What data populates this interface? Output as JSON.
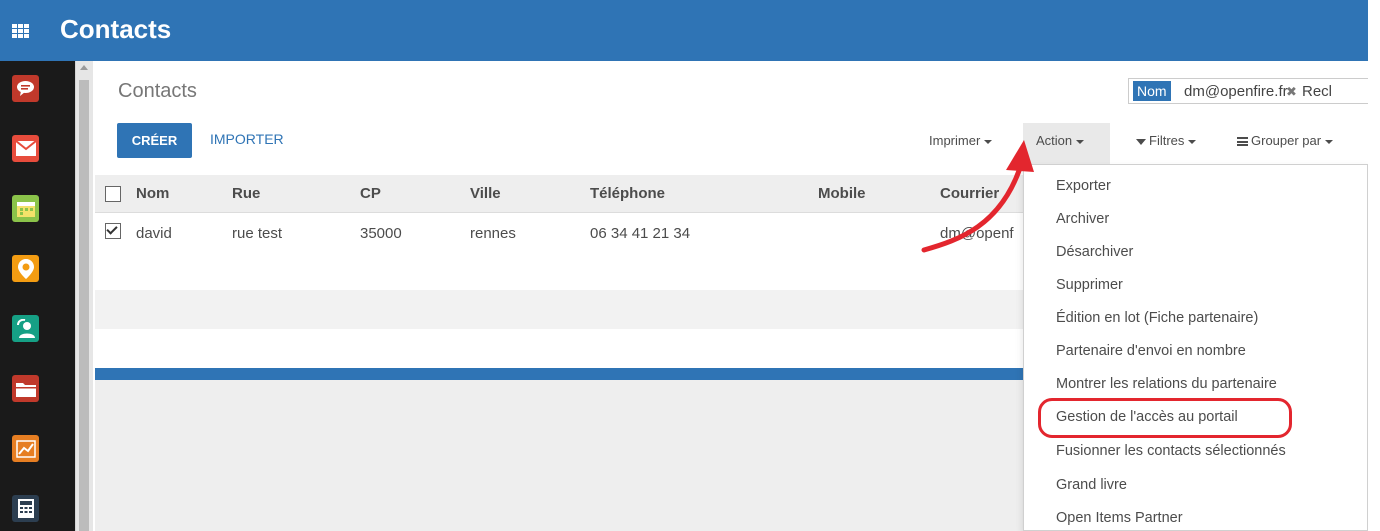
{
  "app": {
    "title": "Contacts"
  },
  "breadcrumb": "Contacts",
  "search": {
    "facet_name": "Nom",
    "facet_value": "dm@openfire.fr",
    "remove_glyph": "✖",
    "input_partial": "Recl"
  },
  "buttons": {
    "create": "CRÉER",
    "import": "IMPORTER"
  },
  "toolbar": {
    "print": "Imprimer",
    "action": "Action",
    "filters": "Filtres",
    "group_by": "Grouper par"
  },
  "table": {
    "columns": [
      "Nom",
      "Rue",
      "CP",
      "Ville",
      "Téléphone",
      "Mobile",
      "Courrier"
    ],
    "rows": [
      {
        "selected": true,
        "nom": "david",
        "rue": "rue test",
        "cp": "35000",
        "ville": "rennes",
        "telephone": "06 34 41 21 34",
        "mobile": "",
        "courriel": "dm@openf"
      }
    ]
  },
  "action_menu": {
    "items": [
      "Exporter",
      "Archiver",
      "Désarchiver",
      "Supprimer",
      "Édition en lot (Fiche partenaire)",
      "Partenaire d'envoi en nombre",
      "Montrer les relations du partenaire",
      "Gestion de l'accès au portail",
      "Fusionner les contacts sélectionnés",
      "Grand livre",
      "Open Items Partner"
    ],
    "highlighted_index": 7
  },
  "sidebar": {
    "icons": [
      {
        "name": "discuss-icon",
        "color": "#c0392b"
      },
      {
        "name": "mail-icon",
        "color": "#e74c3c"
      },
      {
        "name": "calendar-icon",
        "color": "#8bc34a"
      },
      {
        "name": "location-icon",
        "color": "#f39c12"
      },
      {
        "name": "contacts-icon",
        "color": "#16a085"
      },
      {
        "name": "documents-icon",
        "color": "#c0392b"
      },
      {
        "name": "reporting-icon",
        "color": "#e67e22"
      },
      {
        "name": "calculator-icon",
        "color": "#1abc9c"
      }
    ]
  },
  "colors": {
    "brand": "#2f74b5",
    "annotation": "#e3262e"
  }
}
